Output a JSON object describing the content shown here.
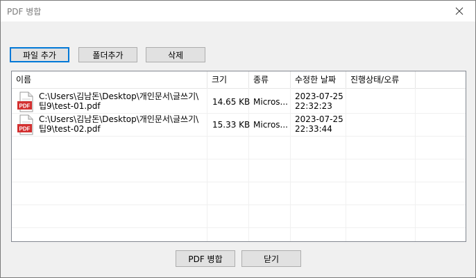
{
  "window": {
    "title": "PDF 병합"
  },
  "toolbar": {
    "add_file": "파일 추가",
    "add_folder": "폴더추가",
    "delete": "삭제"
  },
  "table": {
    "columns": [
      "이름",
      "크기",
      "종류",
      "수정한 날짜",
      "진행상태/오류"
    ],
    "rows": [
      {
        "path_line1": "C:\\Users\\김남돈\\Desktop\\개인문서\\글쓰기\\",
        "path_line2": "팁9\\test-01.pdf",
        "size": "14.65 KB",
        "type": "Micros...",
        "date": "2023-07-25",
        "time": "22:32:23",
        "status": "",
        "icon": "pdf-file-icon",
        "icon_label": "PDF"
      },
      {
        "path_line1": "C:\\Users\\김남돈\\Desktop\\개인문서\\글쓰기\\",
        "path_line2": "팁9\\test-02.pdf",
        "size": "15.33 KB",
        "type": "Micros...",
        "date": "2023-07-25",
        "time": "22:33:44",
        "status": "",
        "icon": "pdf-file-icon",
        "icon_label": "PDF"
      }
    ]
  },
  "footer": {
    "merge": "PDF 병합",
    "close": "닫기"
  },
  "colors": {
    "accent": "#0078d7",
    "pdf_red": "#d32f2f"
  }
}
